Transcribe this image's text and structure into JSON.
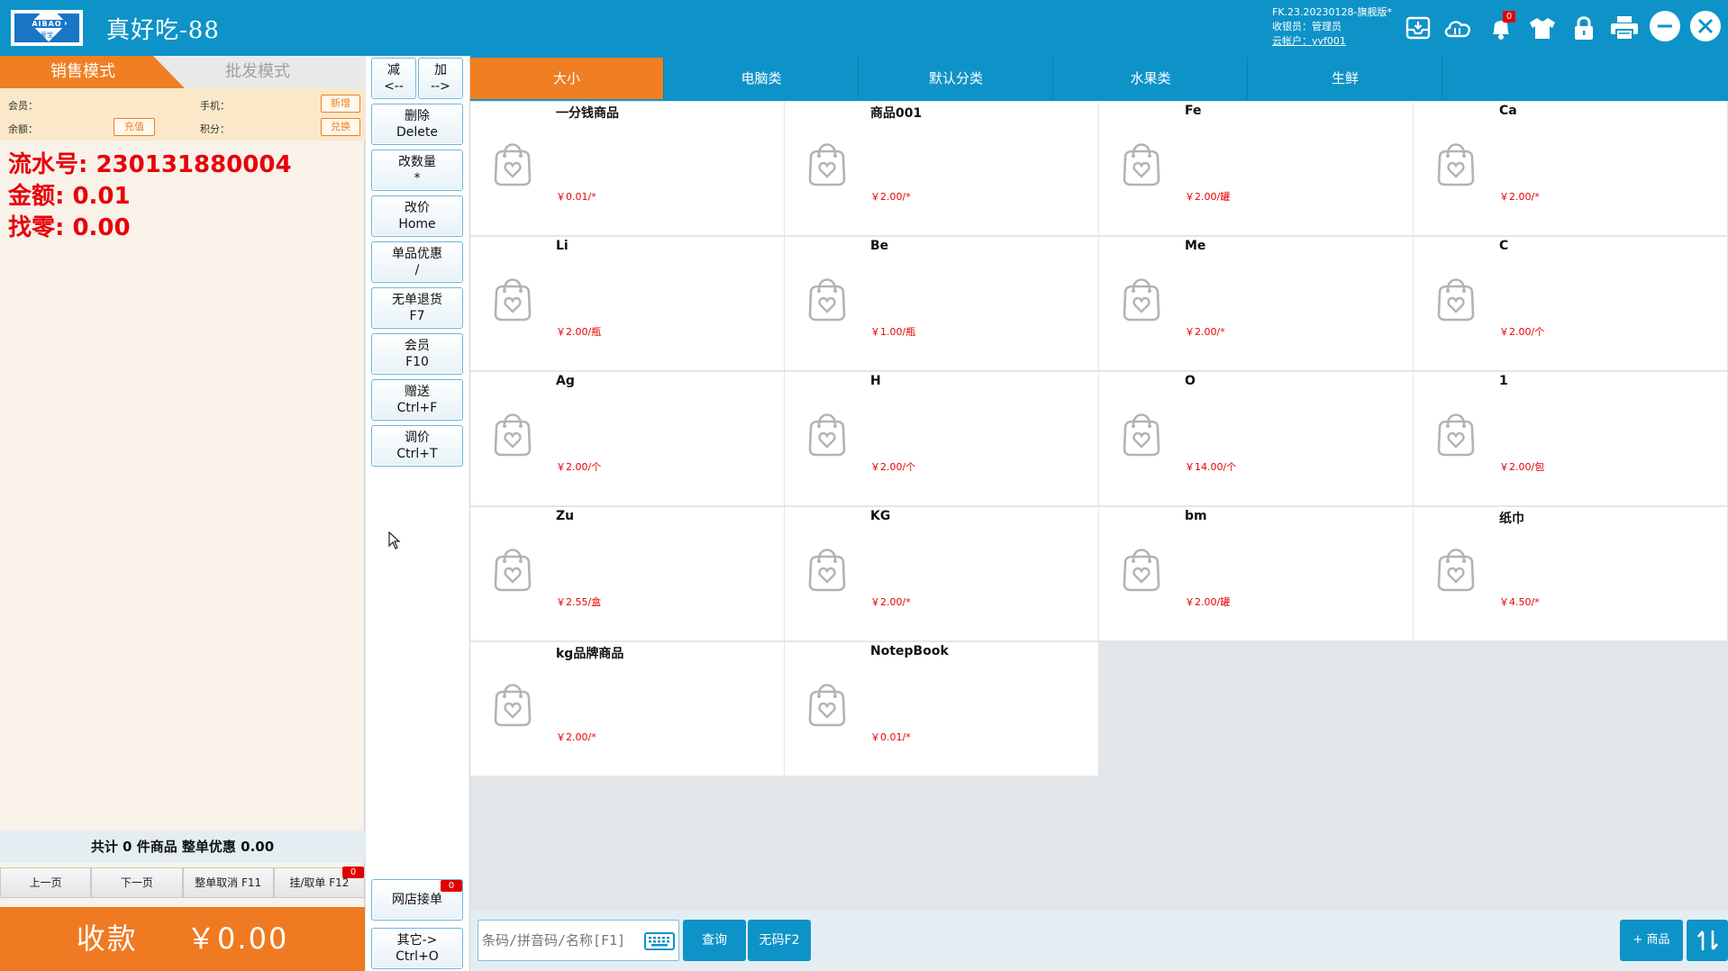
{
  "header": {
    "logo_brand": "AIBAO",
    "logo_sub": "爱宝",
    "store_name": "真好吃-88",
    "version": "FK.23.20230128-旗舰版*",
    "cashier": "收银员：管理员",
    "cloud_account": "云帐户：yyf001",
    "notification_count": "0"
  },
  "left": {
    "tab_sale": "销售模式",
    "tab_wholesale": "批发模式",
    "member_label": "会员：",
    "phone_label": "手机：",
    "balance_label": "余额：",
    "points_label": "积分：",
    "btn_new": "新增",
    "btn_recharge": "充值",
    "btn_exchange": "兑换",
    "serial_line": "流水号: 230131880004",
    "amount_line": "金额: 0.01",
    "change_line": "找零: 0.00",
    "totals": "共计 0 件商品 整单优惠 0.00",
    "prev_page": "上一页",
    "next_page": "下一页",
    "cancel_order": "整单取消 F11",
    "hold_order": "挂/取单 F12",
    "hold_count": "0",
    "pay_label": "收款",
    "pay_amount": "￥0.00"
  },
  "functions": {
    "minus": [
      "减",
      "<--"
    ],
    "plus": [
      "加",
      "-->"
    ],
    "delete": [
      "删除",
      "Delete"
    ],
    "qty": [
      "改数量",
      "*"
    ],
    "price": [
      "改价",
      "Home"
    ],
    "item_discount": [
      "单品优惠",
      "/"
    ],
    "no_receipt_return": [
      "无单退货",
      "F7"
    ],
    "member": [
      "会员",
      "F10"
    ],
    "gift": [
      "赠送",
      "Ctrl+F"
    ],
    "adjust_price": [
      "调价",
      "Ctrl+T"
    ],
    "online_orders": "网店接单",
    "online_count": "0",
    "others": [
      "其它->",
      "Ctrl+O"
    ]
  },
  "categories": [
    "大小",
    "电脑类",
    "默认分类",
    "水果类",
    "生鲜"
  ],
  "products": [
    {
      "name": "一分钱商品",
      "price": "￥0.01/*"
    },
    {
      "name": "商品001",
      "price": "￥2.00/*"
    },
    {
      "name": "Fe",
      "price": "￥2.00/罐"
    },
    {
      "name": "Ca",
      "price": "￥2.00/*"
    },
    {
      "name": "Li",
      "price": "￥2.00/瓶"
    },
    {
      "name": "Be",
      "price": "￥1.00/瓶"
    },
    {
      "name": "Me",
      "price": "￥2.00/*"
    },
    {
      "name": "C",
      "price": "￥2.00/个"
    },
    {
      "name": "Ag",
      "price": "￥2.00/个"
    },
    {
      "name": "H",
      "price": "￥2.00/个"
    },
    {
      "name": "O",
      "price": "￥14.00/个"
    },
    {
      "name": "1",
      "price": "￥2.00/包"
    },
    {
      "name": "Zu",
      "price": "￥2.55/盒"
    },
    {
      "name": "KG",
      "price": "￥2.00/*"
    },
    {
      "name": "bm",
      "price": "￥2.00/罐"
    },
    {
      "name": "纸巾",
      "price": "￥4.50/*"
    },
    {
      "name": "kg品牌商品",
      "price": "￥2.00/*"
    },
    {
      "name": "NotepBook",
      "price": "￥0.01/*"
    }
  ],
  "bottom": {
    "search_placeholder": "条码/拼音码/名称[F1]",
    "query": "查询",
    "no_code": "无码F2",
    "add_product": "+ 商品"
  },
  "colors": {
    "header_blue": "#0e93c8",
    "accent_orange": "#ef7f22",
    "alert_red": "#e8000b"
  }
}
